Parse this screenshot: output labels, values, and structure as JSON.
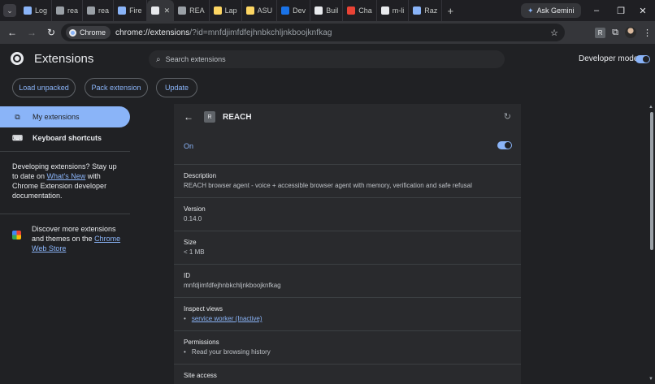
{
  "tabs": [
    {
      "title": "Log",
      "icon": "arrow-icon",
      "color": "#8ab4f8"
    },
    {
      "title": "rea",
      "icon": "globe-icon",
      "color": "#9aa0a6"
    },
    {
      "title": "rea",
      "icon": "globe-icon",
      "color": "#9aa0a6"
    },
    {
      "title": "Fire",
      "icon": "fire-icon",
      "color": "#8ab4f8"
    },
    {
      "title": "",
      "icon": "puzzle-icon",
      "color": "#e8eaed",
      "active": true
    },
    {
      "title": "REA",
      "icon": "globe-icon",
      "color": "#9aa0a6"
    },
    {
      "title": "Lap",
      "icon": "note-icon",
      "color": "#fdd663"
    },
    {
      "title": "ASU",
      "icon": "asu-icon",
      "color": "#fdd663"
    },
    {
      "title": "Dev",
      "icon": "dev-icon",
      "color": "#1a73e8"
    },
    {
      "title": "Buil",
      "icon": "builder-icon",
      "color": "#e8eaed"
    },
    {
      "title": "Cha",
      "icon": "youtube-icon",
      "color": "#ea4335"
    },
    {
      "title": "m-li",
      "icon": "github-icon",
      "color": "#e8eaed"
    },
    {
      "title": "Raz",
      "icon": "razor-icon",
      "color": "#8ab4f8"
    }
  ],
  "ask_gemini": "Ask Gemini",
  "address": {
    "chip_label": "Chrome",
    "host": "chrome://extensions",
    "rest": "/?id=mnfdjimfdfejhnbkchljnkboojknfkag"
  },
  "extension_badge_letter": "R",
  "header": {
    "title": "Extensions",
    "search_placeholder": "Search extensions",
    "developer_mode_label": "Developer mode",
    "developer_mode_on": true
  },
  "dev_buttons": {
    "load_unpacked": "Load unpacked",
    "pack_extension": "Pack extension",
    "update": "Update"
  },
  "sidebar": {
    "items": [
      {
        "label": "My extensions",
        "selected": true
      },
      {
        "label": "Keyboard shortcuts",
        "selected": false
      }
    ],
    "dev_text_1": "Developing extensions? Stay up to date on ",
    "dev_link": "What's New",
    "dev_text_2": " with Chrome Extension developer documentation.",
    "store_text": "Discover more extensions and themes on the ",
    "store_link": "Chrome Web Store"
  },
  "detail": {
    "badge": "R",
    "name": "REACH",
    "status": "On",
    "enabled": true,
    "description_label": "Description",
    "description": "REACH browser agent - voice + accessible browser agent with memory, verification and safe refusal",
    "version_label": "Version",
    "version": "0.14.0",
    "size_label": "Size",
    "size": "< 1 MB",
    "id_label": "ID",
    "id": "mnfdjimfdfejhnbkchljnkboojknfkag",
    "inspect_label": "Inspect views",
    "inspect_link": "service worker (Inactive)",
    "permissions_label": "Permissions",
    "permission_1": "Read your browsing history",
    "site_access_label": "Site access"
  }
}
